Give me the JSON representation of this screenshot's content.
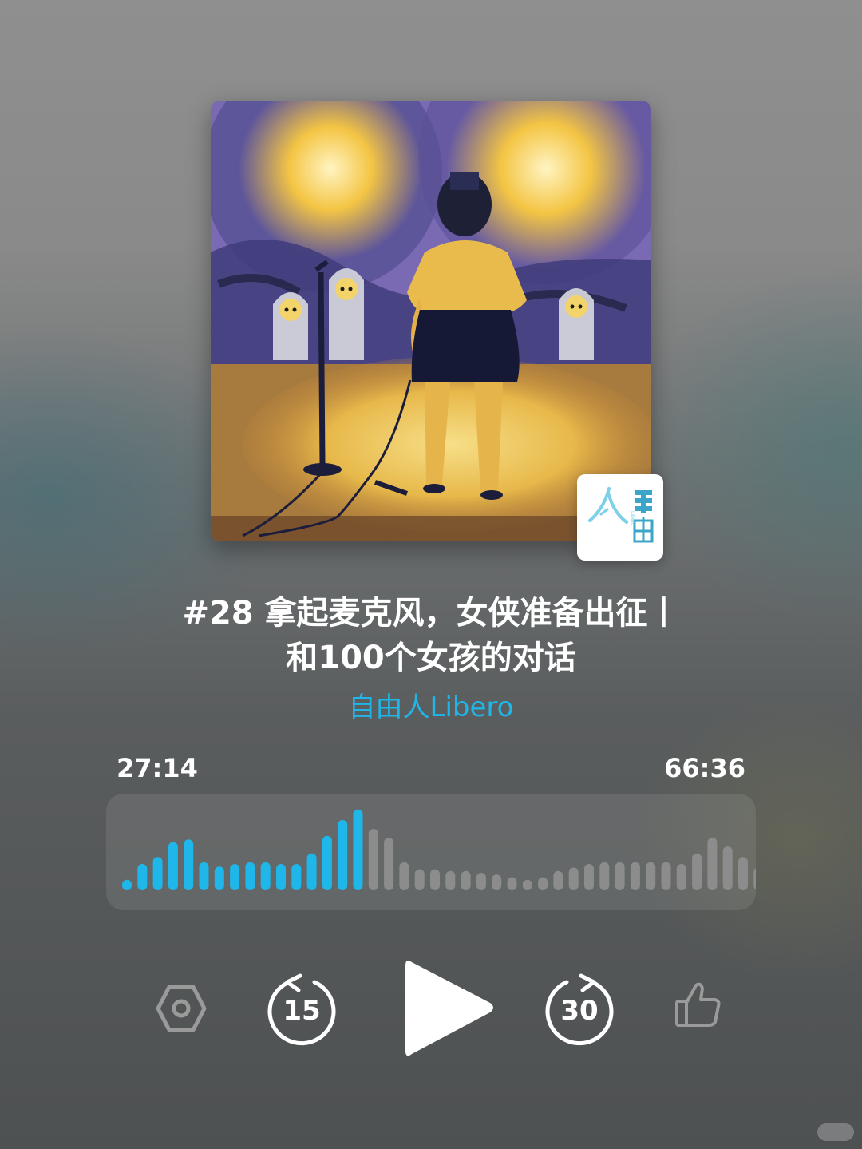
{
  "episode": {
    "title_line1": "#28 拿起麦克风，女侠准备出征丨",
    "title_line2": "和100个女孩的对话",
    "podcast_name": "自由人Libero"
  },
  "player": {
    "elapsed": "27:14",
    "duration": "66:36",
    "progress_fraction": 0.41,
    "rewind_seconds": "15",
    "forward_seconds": "30",
    "accent_color": "#1fb6ea",
    "inactive_bar_color": "#8c8c8c"
  },
  "waveform": {
    "played_bars": [
      0.12,
      0.3,
      0.38,
      0.55,
      0.58,
      0.32,
      0.27,
      0.3,
      0.32,
      0.32,
      0.3,
      0.3,
      0.42,
      0.62,
      0.8,
      0.92
    ],
    "remaining_bars": [
      0.7,
      0.6,
      0.32,
      0.24,
      0.24,
      0.22,
      0.22,
      0.2,
      0.18,
      0.15,
      0.12,
      0.15,
      0.22,
      0.26,
      0.3,
      0.32,
      0.32,
      0.32,
      0.32,
      0.32,
      0.3,
      0.42,
      0.6,
      0.5,
      0.38,
      0.26
    ]
  },
  "logo": {
    "text": "Libero"
  },
  "icons": {
    "settings": "hexagon-settings-icon",
    "rewind": "rewind-15-icon",
    "play": "play-icon",
    "forward": "forward-30-icon",
    "like": "thumbs-up-icon"
  }
}
